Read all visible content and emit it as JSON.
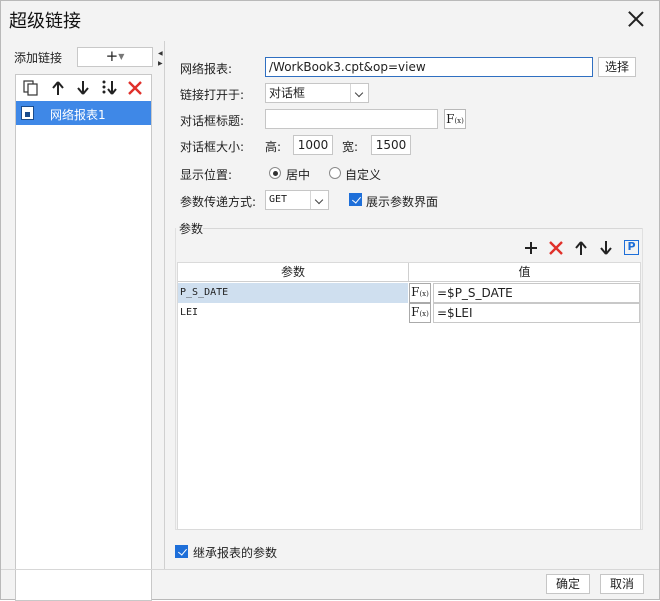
{
  "window": {
    "title": "超级链接"
  },
  "left": {
    "add_label": "添加链接",
    "add_button": "+",
    "items": [
      {
        "label": "网络报表1"
      }
    ]
  },
  "form": {
    "report_label": "网络报表:",
    "report_value": "/WorkBook3.cpt&op=view",
    "choose_button": "选择",
    "open_in_label": "链接打开于:",
    "open_in_value": "对话框",
    "dialog_title_label": "对话框标题:",
    "dialog_title_value": "",
    "dialog_size_label": "对话框大小:",
    "height_label": "高:",
    "height_value": "1000",
    "width_label": "宽:",
    "width_value": "1500",
    "position_label": "显示位置:",
    "position_options": [
      "居中",
      "自定义"
    ],
    "position_selected": "居中",
    "param_method_label": "参数传递方式:",
    "param_method_value": "GET",
    "show_param_ui_label": "展示参数界面",
    "show_param_ui_checked": true
  },
  "params": {
    "group_label": "参数",
    "columns": [
      "参数",
      "值"
    ],
    "rows": [
      {
        "name": "P_S_DATE",
        "value": "=$P_S_DATE"
      },
      {
        "name": "LEI",
        "value": "=$LEI"
      }
    ]
  },
  "footer": {
    "inherit_label": "继承报表的参数",
    "inherit_checked": true,
    "ok_button": "确定",
    "cancel_button": "取消"
  },
  "colors": {
    "accent": "#1e6fd9",
    "selected_item": "#3f88e7",
    "selected_row": "#cfdfef",
    "delete_red": "#e0302a"
  }
}
